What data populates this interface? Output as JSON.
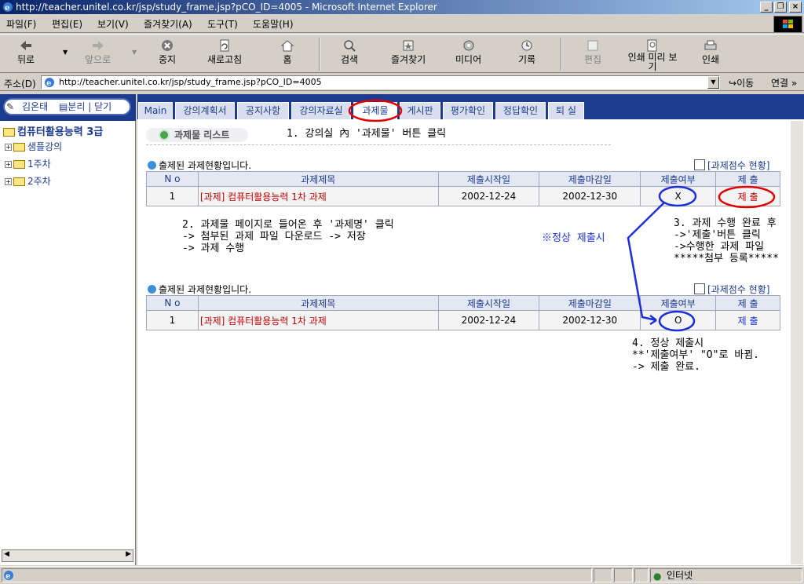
{
  "window": {
    "title": "http://teacher.unitel.co.kr/jsp/study_frame.jsp?pCO_ID=4005 - Microsoft Internet Explorer",
    "min": "_",
    "max": "❐",
    "close": "×"
  },
  "menu": [
    "파일(F)",
    "편집(E)",
    "보기(V)",
    "즐겨찾기(A)",
    "도구(T)",
    "도움말(H)"
  ],
  "toolbar": {
    "back": "뒤로",
    "forward": "앞으로",
    "stop": "중지",
    "refresh": "새로고침",
    "home": "홈",
    "search": "검색",
    "favorites": "즐겨찾기",
    "media": "미디어",
    "history": "기록",
    "edit": "편집",
    "print_preview": "인쇄 미리 보기",
    "print": "인쇄"
  },
  "address": {
    "label": "주소(D)",
    "url": "http://teacher.unitel.co.kr/jsp/study_frame.jsp?pCO_ID=4005",
    "go": "이동",
    "links": "연결 »"
  },
  "left": {
    "user": "김온태",
    "split": "분리",
    "close": "닫기",
    "course": "컴퓨터활용능력 3급",
    "tree": [
      "샘플강의",
      "1주차",
      "2주차"
    ]
  },
  "tabs": [
    "Main",
    "강의계획서",
    "공지사항",
    "강의자료실",
    "과제물",
    "게시판",
    "평가확인",
    "정답확인",
    "퇴 실"
  ],
  "content": {
    "list_title": "과제물 리스트",
    "step1": "1. 강의실 內 '과제물' 버튼 클릭",
    "section_title": "출제된 과제현황입니다.",
    "score_link": "[과제점수 현황]",
    "headers": [
      "N o",
      "과제제목",
      "제출시작일",
      "제출마감일",
      "제출여부",
      "제 출"
    ],
    "row1": {
      "no": "1",
      "title": "[과제] 컴퓨터활용능력 1차 과제",
      "start": "2002-12-24",
      "end": "2002-12-30",
      "submitted": "X",
      "action": "제 출"
    },
    "row2": {
      "no": "1",
      "title": "[과제] 컴퓨터활용능력 1차 과제",
      "start": "2002-12-24",
      "end": "2002-12-30",
      "submitted": "O",
      "action": "제 출"
    },
    "step2_l1": "2. 과제물 페이지로 들어온 후 '과제명' 클릭",
    "step2_l2": "-> 첨부된 과제 파일 다운로드 -> 저장",
    "step2_l3": "-> 과제 수행",
    "normal": "※정상 제출시",
    "step3_l1": "3. 과제 수행 완료 후",
    "step3_l2": "->'제출'버튼 클릭",
    "step3_l3": "->수행한 과제 파일",
    "step3_l4": "*****첨부 등록*****",
    "step4_l1": "4. 정상 제출시",
    "step4_l2": "**'제출여부' \"O\"로 바뀜.",
    "step4_l3": "-> 제출 완료."
  },
  "status": {
    "zone": "인터넷"
  },
  "colors": {
    "annotation_red": "#e00000",
    "annotation_blue": "#1c2fd8",
    "frame_blue": "#1c3b8f"
  }
}
